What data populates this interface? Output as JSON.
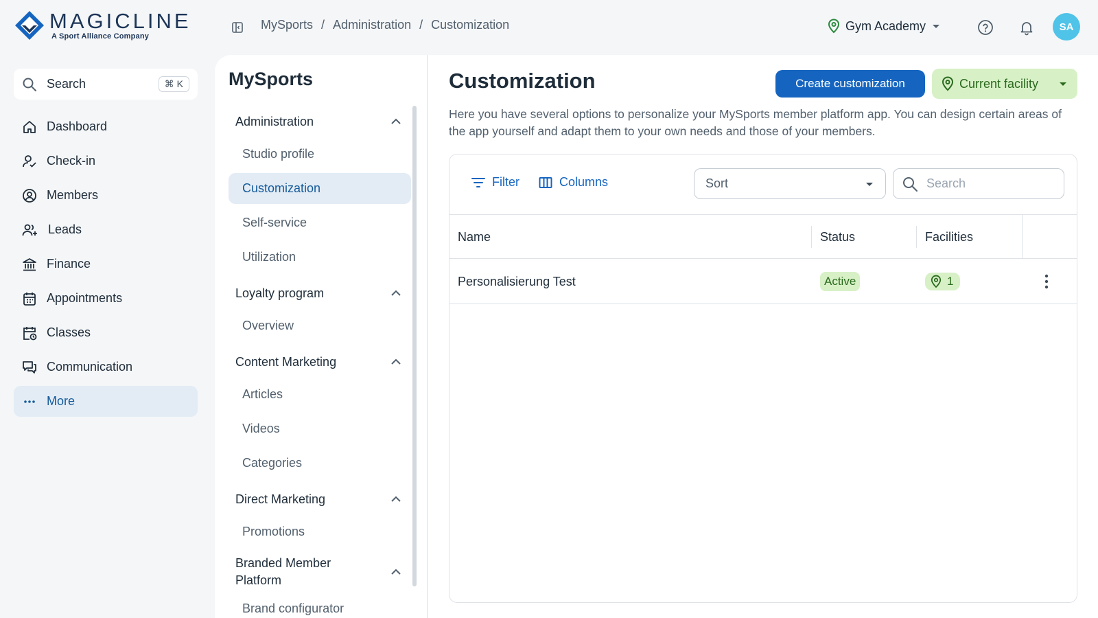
{
  "brand": {
    "name": "MAGICLINE",
    "tagline": "A Sport Alliance Company",
    "accent": "#1565c0",
    "success_bg": "#d7f0c6",
    "success_text": "#2b6a1e"
  },
  "header": {
    "breadcrumb": [
      "MySports",
      "Administration",
      "Customization"
    ],
    "facility": "Gym Academy",
    "avatar_initials": "SA"
  },
  "sidebar": {
    "search_label": "Search",
    "search_shortcut": "⌘ K",
    "items": [
      {
        "label": "Dashboard",
        "icon": "home-icon"
      },
      {
        "label": "Check-in",
        "icon": "check-in-icon"
      },
      {
        "label": "Members",
        "icon": "members-icon"
      },
      {
        "label": "Leads",
        "icon": "leads-icon"
      },
      {
        "label": "Finance",
        "icon": "bank-icon"
      },
      {
        "label": "Appointments",
        "icon": "calendar-icon"
      },
      {
        "label": "Classes",
        "icon": "classes-icon"
      },
      {
        "label": "Communication",
        "icon": "chat-icon"
      },
      {
        "label": "More",
        "icon": "more-icon",
        "active": true
      }
    ]
  },
  "subnav": {
    "title": "MySports",
    "groups": [
      {
        "label": "Administration",
        "items": [
          "Studio profile",
          "Customization",
          "Self-service",
          "Utilization"
        ]
      },
      {
        "label": "Loyalty program",
        "items": [
          "Overview"
        ]
      },
      {
        "label": "Content Marketing",
        "items": [
          "Articles",
          "Videos",
          "Categories"
        ]
      },
      {
        "label": "Direct Marketing",
        "items": [
          "Promotions"
        ]
      },
      {
        "label": "Branded Member Platform",
        "items": [
          "Brand configurator"
        ]
      }
    ],
    "active_item": "Customization"
  },
  "main": {
    "title": "Customization",
    "create_button": "Create customization",
    "facility_button": "Current facility",
    "description": "Here you have several options to personalize your MySports member platform app. You can design certain areas of the app yourself and adapt them to your own needs and those of your members.",
    "toolbar": {
      "filter_label": "Filter",
      "columns_label": "Columns",
      "sort_label": "Sort",
      "search_placeholder": "Search"
    },
    "table": {
      "columns": [
        "Name",
        "Status",
        "Facilities"
      ],
      "rows": [
        {
          "name": "Personalisierung Test",
          "status": "Active",
          "facilities": "1"
        }
      ]
    }
  }
}
